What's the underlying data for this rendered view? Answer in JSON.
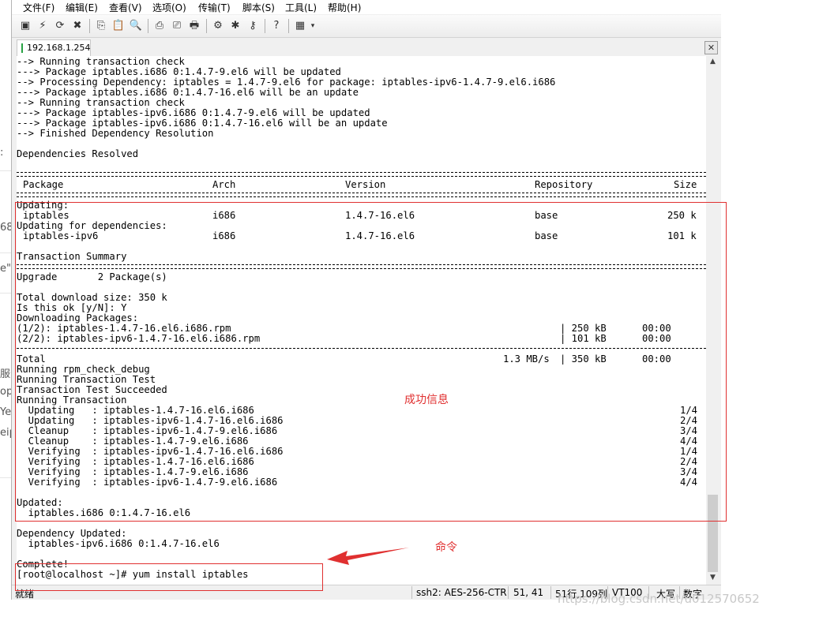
{
  "menu": [
    "文件(F)",
    "编辑(E)",
    "查看(V)",
    "选项(O)",
    "传输(T)",
    "脚本(S)",
    "工具(L)",
    "帮助(H)"
  ],
  "tab": {
    "label": "192.168.1.254",
    "close": "✕"
  },
  "left_strip": [
    ":",
    "68",
    "e\"",
    "服务",
    "opp",
    "Yet",
    "eip"
  ],
  "terminal": {
    "pre_lines": [
      "--> Running transaction check",
      "---> Package iptables.i686 0:1.4.7-9.el6 will be updated",
      "--> Processing Dependency: iptables = 1.4.7-9.el6 for package: iptables-ipv6-1.4.7-9.el6.i686",
      "---> Package iptables.i686 0:1.4.7-16.el6 will be an update",
      "--> Running transaction check",
      "---> Package iptables-ipv6.i686 0:1.4.7-9.el6 will be updated",
      "---> Package iptables-ipv6.i686 0:1.4.7-16.el6 will be an update",
      "--> Finished Dependency Resolution",
      "",
      "Dependencies Resolved"
    ],
    "table_header": {
      "package": "Package",
      "arch": "Arch",
      "version": "Version",
      "repository": "Repository",
      "size": "Size"
    },
    "updating_label": "Updating:",
    "row1": {
      "package": "iptables",
      "arch": "i686",
      "version": "1.4.7-16.el6",
      "repository": "base",
      "size": "250 k"
    },
    "deps_label": "Updating for dependencies:",
    "row2": {
      "package": "iptables-ipv6",
      "arch": "i686",
      "version": "1.4.7-16.el6",
      "repository": "base",
      "size": "101 k"
    },
    "summary_title": "Transaction Summary",
    "upgrade_line": "Upgrade       2 Package(s)",
    "download_lines": [
      "Total download size: 350 k",
      "Is this ok [y/N]: Y",
      "Downloading Packages:"
    ],
    "dl1": {
      "name": "(1/2): iptables-1.4.7-16.el6.i686.rpm",
      "size": "| 250 kB",
      "time": "00:00"
    },
    "dl2": {
      "name": "(2/2): iptables-ipv6-1.4.7-16.el6.i686.rpm",
      "size": "| 101 kB",
      "time": "00:00"
    },
    "total": {
      "label": "Total",
      "rate": "1.3 MB/s",
      "size": "| 350 kB",
      "time": "00:00"
    },
    "run_lines": [
      "Running rpm_check_debug",
      "Running Transaction Test",
      "Transaction Test Succeeded",
      "Running Transaction"
    ],
    "steps": [
      {
        "text": "  Updating   : iptables-1.4.7-16.el6.i686",
        "count": "1/4"
      },
      {
        "text": "  Updating   : iptables-ipv6-1.4.7-16.el6.i686",
        "count": "2/4"
      },
      {
        "text": "  Cleanup    : iptables-ipv6-1.4.7-9.el6.i686",
        "count": "3/4"
      },
      {
        "text": "  Cleanup    : iptables-1.4.7-9.el6.i686",
        "count": "4/4"
      },
      {
        "text": "  Verifying  : iptables-ipv6-1.4.7-16.el6.i686",
        "count": "1/4"
      },
      {
        "text": "  Verifying  : iptables-1.4.7-16.el6.i686",
        "count": "2/4"
      },
      {
        "text": "  Verifying  : iptables-1.4.7-9.el6.i686",
        "count": "3/4"
      },
      {
        "text": "  Verifying  : iptables-ipv6-1.4.7-9.el6.i686",
        "count": "4/4"
      }
    ],
    "end_lines": [
      "",
      "Updated:",
      "  iptables.i686 0:1.4.7-16.el6",
      "",
      "Dependency Updated:",
      "  iptables-ipv6.i686 0:1.4.7-16.el6",
      "",
      "Complete!",
      "[root@localhost ~]# yum install iptables"
    ]
  },
  "annotations": {
    "success": "成功信息",
    "command": "命令"
  },
  "statusbar": {
    "ready": "就绪",
    "cipher": "ssh2: AES-256-CTR",
    "cursor": "51, 41",
    "size": "51行,109列",
    "term": "VT100",
    "caps": "大写",
    "num": "数字"
  },
  "watermark": "https://blog.csdn.net/u012570652"
}
